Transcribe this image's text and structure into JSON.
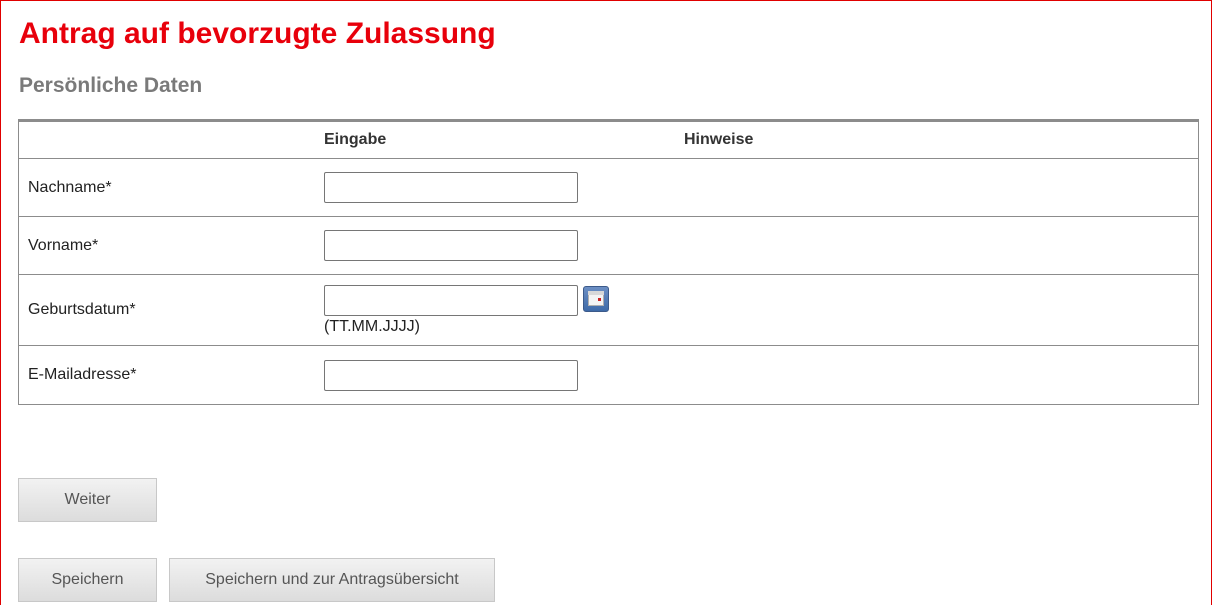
{
  "page": {
    "title": "Antrag auf bevorzugte Zulassung",
    "subtitle": "Persönliche Daten"
  },
  "table": {
    "headers": {
      "label": "",
      "input": "Eingabe",
      "hints": "Hinweise"
    },
    "rows": [
      {
        "label": "Nachname*",
        "value": "",
        "placeholder": ""
      },
      {
        "label": "Vorname*",
        "value": "",
        "placeholder": ""
      },
      {
        "label": "Geburtsdatum*",
        "value": "",
        "placeholder": "",
        "format_hint": "(TT.MM.JJJJ)",
        "icon": "calendar-icon"
      },
      {
        "label": "E-Mailadresse*",
        "value": "",
        "placeholder": ""
      }
    ]
  },
  "buttons": {
    "next": "Weiter",
    "save": "Speichern",
    "save_and_overview": "Speichern und zur Antragsübersicht"
  },
  "colors": {
    "title": "#e8000b",
    "subtitle": "#7a7a7a",
    "frame_border": "#e00000",
    "table_border": "#8c8c8c",
    "button_text": "#555555"
  }
}
